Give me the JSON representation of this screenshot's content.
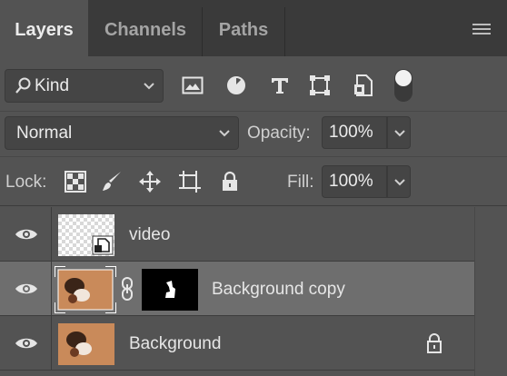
{
  "tabs": [
    {
      "label": "Layers",
      "active": true
    },
    {
      "label": "Channels",
      "active": false
    },
    {
      "label": "Paths",
      "active": false
    }
  ],
  "filter": {
    "kind_label": "Kind",
    "icons": [
      "image-filter-icon",
      "adjustment-filter-icon",
      "type-filter-icon",
      "shape-filter-icon",
      "smart-object-filter-icon"
    ],
    "filter_on": true
  },
  "blend": {
    "mode": "Normal",
    "opacity_label": "Opacity:",
    "opacity_value": "100%"
  },
  "lock": {
    "label": "Lock:",
    "icons": [
      "lock-transparent-pixels-icon",
      "lock-image-pixels-icon",
      "lock-position-icon",
      "prevent-auto-nesting-icon",
      "lock-all-icon"
    ],
    "fill_label": "Fill:",
    "fill_value": "100%"
  },
  "layers": [
    {
      "name": "video",
      "visible": true,
      "selected": false,
      "type": "smart-object",
      "locked": false
    },
    {
      "name": "Background copy",
      "visible": true,
      "selected": true,
      "type": "masked",
      "locked": false
    },
    {
      "name": "Background",
      "visible": true,
      "selected": false,
      "type": "background",
      "locked": true
    }
  ],
  "colors": {
    "panel": "#535353",
    "tabbar": "#3a3a3a",
    "selected_row": "#6e6e6e",
    "field": "#454545"
  }
}
